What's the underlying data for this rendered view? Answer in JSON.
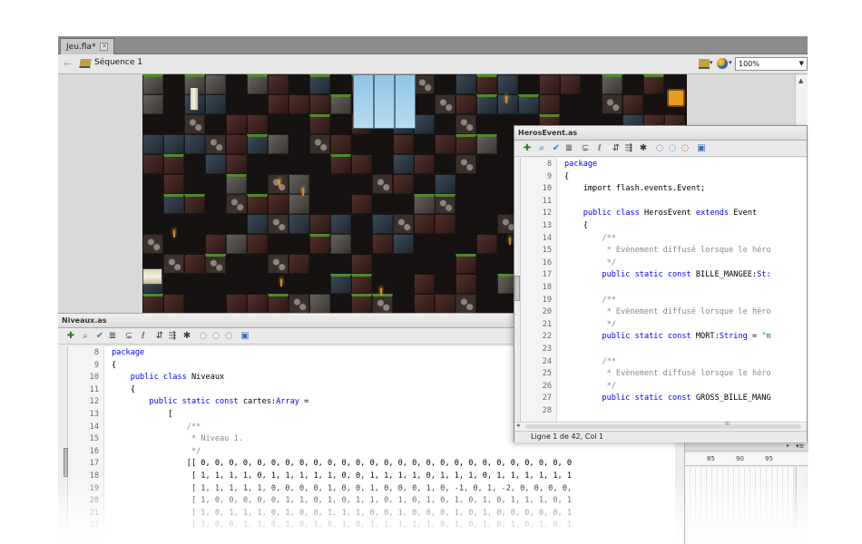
{
  "document_tab": {
    "label": "Jeu.fla*",
    "close": "✕"
  },
  "edit_bar": {
    "back": "←",
    "scene_label": "Séquence 1",
    "zoom": "100%",
    "zoom_arrow": "▼"
  },
  "stage_scroll": {
    "up": "▲"
  },
  "heros_panel": {
    "title": "HerosEvent.as",
    "toolbar_icons": [
      "add-item-icon",
      "find-icon",
      "check-syntax-icon",
      "auto-format-icon",
      "code-hint-icon",
      "debug-options-icon",
      "collapse-braces-icon",
      "collapse-selection-icon",
      "expand-all-icon",
      "block-comment-icon",
      "line-comment-icon",
      "remove-comment-icon",
      "toolbox-icon"
    ],
    "toolbar_glyphs": [
      "✚",
      "⌕",
      "✔",
      "≣",
      "⊊",
      "ℓ",
      "⇵",
      "⇶",
      "✱",
      "◌",
      "◌",
      "◌",
      "▣"
    ],
    "lines": [
      {
        "n": "8",
        "segments": [
          {
            "t": "package",
            "c": "kw"
          }
        ]
      },
      {
        "n": "9",
        "segments": [
          {
            "t": "{",
            "c": ""
          }
        ]
      },
      {
        "n": "10",
        "segments": [
          {
            "t": "    import flash.events.Event;",
            "c": ""
          }
        ]
      },
      {
        "n": "11",
        "segments": []
      },
      {
        "n": "12",
        "segments": [
          {
            "t": "    public class ",
            "c": "kw"
          },
          {
            "t": "HerosEvent ",
            "c": ""
          },
          {
            "t": "extends ",
            "c": "kw"
          },
          {
            "t": "Event",
            "c": ""
          }
        ]
      },
      {
        "n": "13",
        "segments": [
          {
            "t": "    {",
            "c": ""
          }
        ]
      },
      {
        "n": "14",
        "segments": [
          {
            "t": "        /**",
            "c": "cm"
          }
        ]
      },
      {
        "n": "15",
        "segments": [
          {
            "t": "         * Evènement diffusé lorsque le héro",
            "c": "cm"
          }
        ]
      },
      {
        "n": "16",
        "segments": [
          {
            "t": "         */",
            "c": "cm"
          }
        ]
      },
      {
        "n": "17",
        "segments": [
          {
            "t": "        public static const ",
            "c": "kw"
          },
          {
            "t": "BILLE_MANGEE:",
            "c": ""
          },
          {
            "t": "St:",
            "c": "ty"
          }
        ]
      },
      {
        "n": "18",
        "segments": []
      },
      {
        "n": "19",
        "segments": [
          {
            "t": "        /**",
            "c": "cm"
          }
        ]
      },
      {
        "n": "20",
        "segments": [
          {
            "t": "         * Evènement diffusé lorsque le héro",
            "c": "cm"
          }
        ]
      },
      {
        "n": "21",
        "segments": [
          {
            "t": "         */",
            "c": "cm"
          }
        ]
      },
      {
        "n": "22",
        "segments": [
          {
            "t": "        public static const ",
            "c": "kw"
          },
          {
            "t": "MORT:",
            "c": ""
          },
          {
            "t": "String",
            "c": "ty"
          },
          {
            "t": " = ",
            "c": ""
          },
          {
            "t": "\"m",
            "c": "st"
          }
        ]
      },
      {
        "n": "23",
        "segments": []
      },
      {
        "n": "24",
        "segments": [
          {
            "t": "        /**",
            "c": "cm"
          }
        ]
      },
      {
        "n": "25",
        "segments": [
          {
            "t": "         * Evènement diffusé lorsque le héro",
            "c": "cm"
          }
        ]
      },
      {
        "n": "26",
        "segments": [
          {
            "t": "         */",
            "c": "cm"
          }
        ]
      },
      {
        "n": "27",
        "segments": [
          {
            "t": "        public static const ",
            "c": "kw"
          },
          {
            "t": "GROSS_BILLE_MANG",
            "c": ""
          }
        ]
      },
      {
        "n": "28",
        "segments": []
      }
    ],
    "status": "Ligne 1 de 42, Col 1",
    "hscroll_left": "◂",
    "hscroll_grip": "III"
  },
  "niveaux_panel": {
    "title": "Niveaux.as",
    "toolbar_glyphs": [
      "✚",
      "⌕",
      "✔",
      "≣",
      "⊊",
      "ℓ",
      "⇵",
      "⇶",
      "✱",
      "◌",
      "◌",
      "◌",
      "▣"
    ],
    "lines": [
      {
        "n": "8",
        "segments": [
          {
            "t": "package",
            "c": "kw"
          }
        ]
      },
      {
        "n": "9",
        "segments": [
          {
            "t": "{",
            "c": ""
          }
        ]
      },
      {
        "n": "10",
        "segments": [
          {
            "t": "    public class ",
            "c": "kw"
          },
          {
            "t": "Niveaux",
            "c": ""
          }
        ]
      },
      {
        "n": "11",
        "segments": [
          {
            "t": "    {",
            "c": ""
          }
        ]
      },
      {
        "n": "12",
        "segments": [
          {
            "t": "        public static const ",
            "c": "kw"
          },
          {
            "t": "cartes:",
            "c": ""
          },
          {
            "t": "Array",
            "c": "ty"
          },
          {
            "t": " =",
            "c": ""
          }
        ]
      },
      {
        "n": "13",
        "segments": [
          {
            "t": "            [",
            "c": ""
          }
        ]
      },
      {
        "n": "14",
        "segments": [
          {
            "t": "                /**",
            "c": "cm"
          }
        ]
      },
      {
        "n": "15",
        "segments": [
          {
            "t": "                 * Niveau 1.",
            "c": "cm"
          }
        ]
      },
      {
        "n": "16",
        "segments": [
          {
            "t": "                 */",
            "c": "cm"
          }
        ]
      },
      {
        "n": "17",
        "segments": [
          {
            "t": "                [[ 0, 0, 0, 0, 0, 0, 0, 0, 0, 0, 0, 0, 0, 0, 0, 0, 0, 0, 0, 0, 0, 0, 0, 0, 0, 0, 0",
            "c": ""
          }
        ]
      },
      {
        "n": "18",
        "segments": [
          {
            "t": "                 [ 1, 1, 1, 1, 0, 1, 1, 1, 1, 1, 0, 0, 1, 1, 1, 1, 0, 1, 1, 1, 0, 1, 1, 1, 1, 1, 1",
            "c": ""
          }
        ]
      },
      {
        "n": "19",
        "segments": [
          {
            "t": "                 [ 1, 1, 1, 1, 1, 0, 0, 0, 0, 1, 0, 0, 1, 0, 0, 0, 1, 0, -1, 0, 1, -2, 0, 0, 0, 0,",
            "c": ""
          }
        ]
      },
      {
        "n": "20",
        "segments": [
          {
            "t": "                 [ 1, 0, 0, 0, 0, 0, 1, 1, 0, 1, 0, 1, 1, 0, 1, 0, 1, 0, 1, 0, 1, 0, 1, 1, 1, 0, 1",
            "c": ""
          }
        ]
      },
      {
        "n": "21",
        "segments": [
          {
            "t": "                 [ 1, 0, 1, 1, 1, 0, 1, 0, 0, 1, 1, 1, 0, 0, 1, 0, 0, 0, 1, 0, 1, 0, 0, 0, 0, 0, 1",
            "c": ""
          }
        ]
      },
      {
        "n": "22",
        "segments": [
          {
            "t": "                 [ 1, 0, 0, 1, 1, 0, 1, 0, 1, 0, 1, 0, 1, 1, 1, 1, 1, 0, 1, 0, 1, 0, 1, 0, 1, 0, 1",
            "c": ""
          }
        ]
      }
    ]
  },
  "timeline": {
    "ruler": [
      "85",
      "90",
      "95"
    ],
    "arrow": "▸",
    "menu": "▾≡"
  }
}
